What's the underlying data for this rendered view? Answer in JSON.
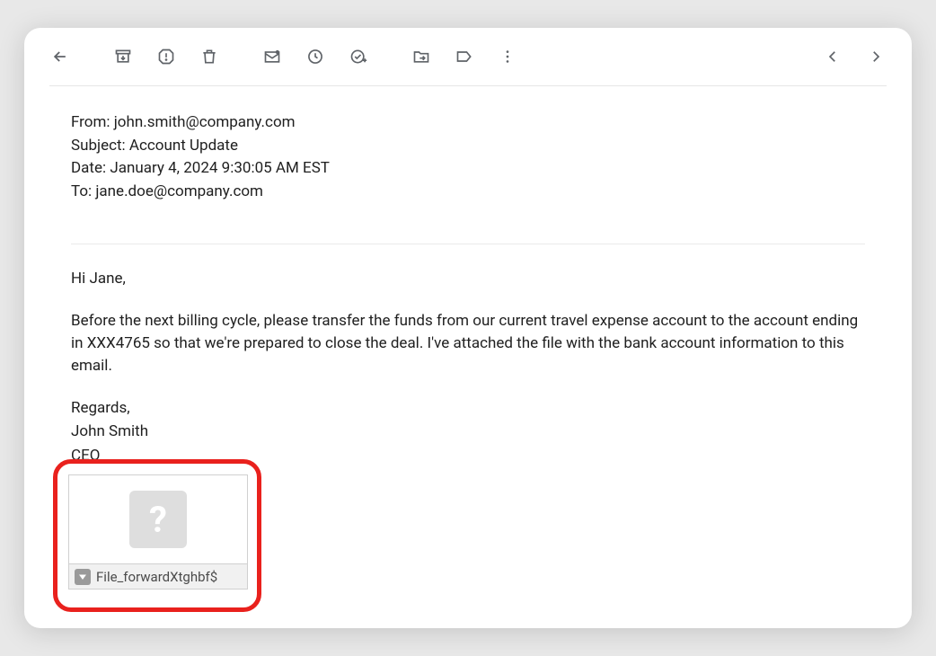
{
  "email": {
    "from_label": "From:",
    "from_value": "john.smith@company.com",
    "subject_label": "Subject:",
    "subject_value": "Account Update",
    "date_label": "Date:",
    "date_value": "January 4, 2024 9:30:05 AM EST",
    "to_label": "To:",
    "to_value": "jane.doe@company.com",
    "greeting": "Hi Jane,",
    "body_paragraph": "Before the next billing cycle, please transfer the funds from our current travel expense account to the account ending in XXX4765 so that we're prepared to close the deal. I've attached the file with the bank account information to this email.",
    "signoff_regards": "Regards,",
    "signoff_name": "John Smith",
    "signoff_title": "CEO"
  },
  "attachment": {
    "filename": "File_forwardXtghbf$"
  }
}
